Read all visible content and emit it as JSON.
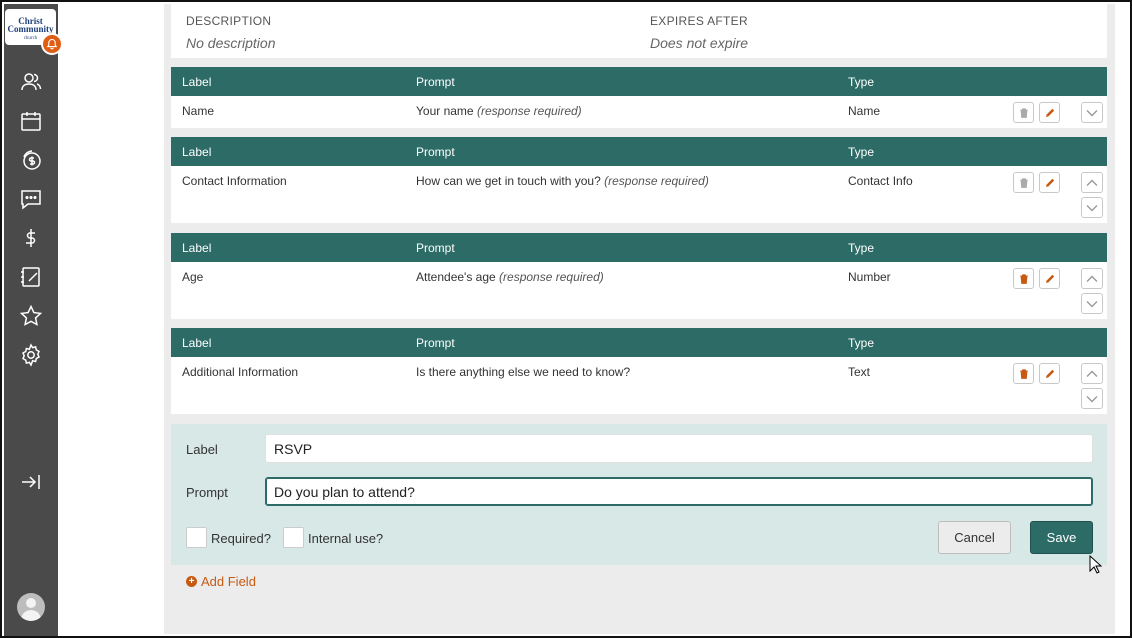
{
  "sidebar": {
    "logo_line1": "Christ",
    "logo_line2": "Community",
    "logo_line3": "church",
    "icons": [
      "people-icon",
      "calendar-icon",
      "giving-icon",
      "chat-icon",
      "dollar-icon",
      "notes-icon",
      "star-icon",
      "gear-icon",
      "collapse-icon"
    ]
  },
  "meta": {
    "description_label": "DESCRIPTION",
    "description_value": "No description",
    "expires_label": "EXPIRES AFTER",
    "expires_value": "Does not expire"
  },
  "columns": {
    "label": "Label",
    "prompt": "Prompt",
    "type": "Type"
  },
  "fields": [
    {
      "label": "Name",
      "prompt": "Your name",
      "required": "(response required)",
      "type": "Name"
    },
    {
      "label": "Contact Information",
      "prompt": "How can we get in touch with you?",
      "required": "(response required)",
      "type": "Contact Info"
    },
    {
      "label": "Age",
      "prompt": "Attendee's age",
      "required": "(response required)",
      "type": "Number"
    },
    {
      "label": "Additional Information",
      "prompt": "Is there anything else we need to know?",
      "required": "",
      "type": "Text"
    }
  ],
  "edit": {
    "label_caption": "Label",
    "label_value": "RSVP",
    "prompt_caption": "Prompt",
    "prompt_value": "Do you plan to attend?",
    "required_label": "Required?",
    "internal_label": "Internal use?",
    "cancel_label": "Cancel",
    "save_label": "Save"
  },
  "add_field_label": "Add Field",
  "colors": {
    "teal": "#2c6b66",
    "orange": "#c65a13",
    "sidebar": "#4a4a4a"
  }
}
